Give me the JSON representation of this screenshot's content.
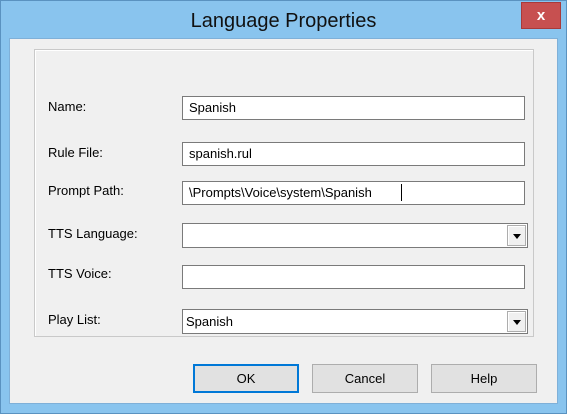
{
  "window": {
    "title": "Language Properties",
    "close_label": "x"
  },
  "form": {
    "name": {
      "label": "Name:",
      "value": "Spanish"
    },
    "rule_file": {
      "label": "Rule File:",
      "value": "spanish.rul"
    },
    "prompt_path": {
      "label": "Prompt Path:",
      "value": "\\Prompts\\Voice\\system\\Spanish"
    },
    "tts_language": {
      "label": "TTS Language:",
      "value": ""
    },
    "tts_voice": {
      "label": "TTS Voice:",
      "value": ""
    },
    "play_list": {
      "label": "Play List:",
      "value": "Spanish"
    }
  },
  "buttons": {
    "ok": "OK",
    "cancel": "Cancel",
    "help": "Help"
  },
  "colors": {
    "titlebar": "#89c4ee",
    "close_button": "#c75050",
    "dialog_background": "#f0f0f0"
  }
}
